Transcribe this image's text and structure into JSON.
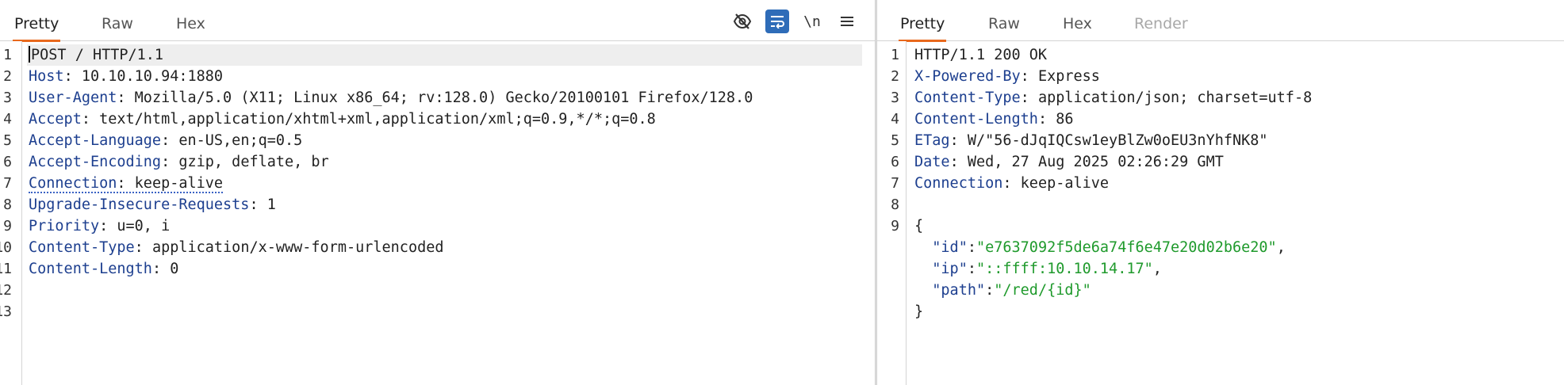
{
  "request": {
    "tabs": [
      {
        "label": "Pretty"
      },
      {
        "label": "Raw"
      },
      {
        "label": "Hex"
      }
    ],
    "toolbar": {
      "icons": [
        "hide-eye-icon",
        "wrap-lines-icon",
        "newline-icon",
        "menu-icon"
      ],
      "newline_label": "\\n"
    },
    "line_numbers": [
      "1",
      "2",
      "3",
      "4",
      "5",
      "6",
      "7",
      "8",
      "9",
      "10",
      "11",
      "12",
      "13"
    ],
    "request_line": "POST / HTTP/1.1",
    "headers": [
      {
        "name": "Host",
        "value": "10.10.10.94:1880"
      },
      {
        "name": "User-Agent",
        "value": "Mozilla/5.0 (X11; Linux x86_64; rv:128.0) Gecko/20100101 Firefox/128.0"
      },
      {
        "name": "Accept",
        "value": "text/html,application/xhtml+xml,application/xml;q=0.9,*/*;q=0.8"
      },
      {
        "name": "Accept-Language",
        "value": "en-US,en;q=0.5"
      },
      {
        "name": "Accept-Encoding",
        "value": "gzip, deflate, br"
      },
      {
        "name": "Connection",
        "value": "keep-alive"
      },
      {
        "name": "Upgrade-Insecure-Requests",
        "value": "1"
      },
      {
        "name": "Priority",
        "value": "u=0, i"
      },
      {
        "name": "Content-Type",
        "value": "application/x-www-form-urlencoded"
      },
      {
        "name": "Content-Length",
        "value": "0"
      }
    ]
  },
  "response": {
    "tabs": [
      {
        "label": "Pretty"
      },
      {
        "label": "Raw"
      },
      {
        "label": "Hex"
      },
      {
        "label": "Render"
      }
    ],
    "line_numbers": [
      "1",
      "2",
      "3",
      "4",
      "5",
      "6",
      "7",
      "8",
      "9"
    ],
    "status_line": "HTTP/1.1 200 OK",
    "headers": [
      {
        "name": "X-Powered-By",
        "value": "Express"
      },
      {
        "name": "Content-Type",
        "value": "application/json; charset=utf-8"
      },
      {
        "name": "Content-Length",
        "value": "86"
      },
      {
        "name": "ETag",
        "value": "W/\"56-dJqIQCsw1eyBlZw0oEU3nYhfNK8\""
      },
      {
        "name": "Date",
        "value": "Wed, 27 Aug 2025 02:26:29 GMT"
      },
      {
        "name": "Connection",
        "value": "keep-alive"
      }
    ],
    "body": {
      "open_brace": "{",
      "close_brace": "}",
      "fields": [
        {
          "key": "\"id\"",
          "value": "\"e7637092f5de6a74f6e47e20d02b6e20\"",
          "trail": ","
        },
        {
          "key": "\"ip\"",
          "value": "\"::ffff:10.10.14.17\"",
          "trail": ","
        },
        {
          "key": "\"path\"",
          "value": "\"/red/{id}\"",
          "trail": ""
        }
      ]
    }
  }
}
